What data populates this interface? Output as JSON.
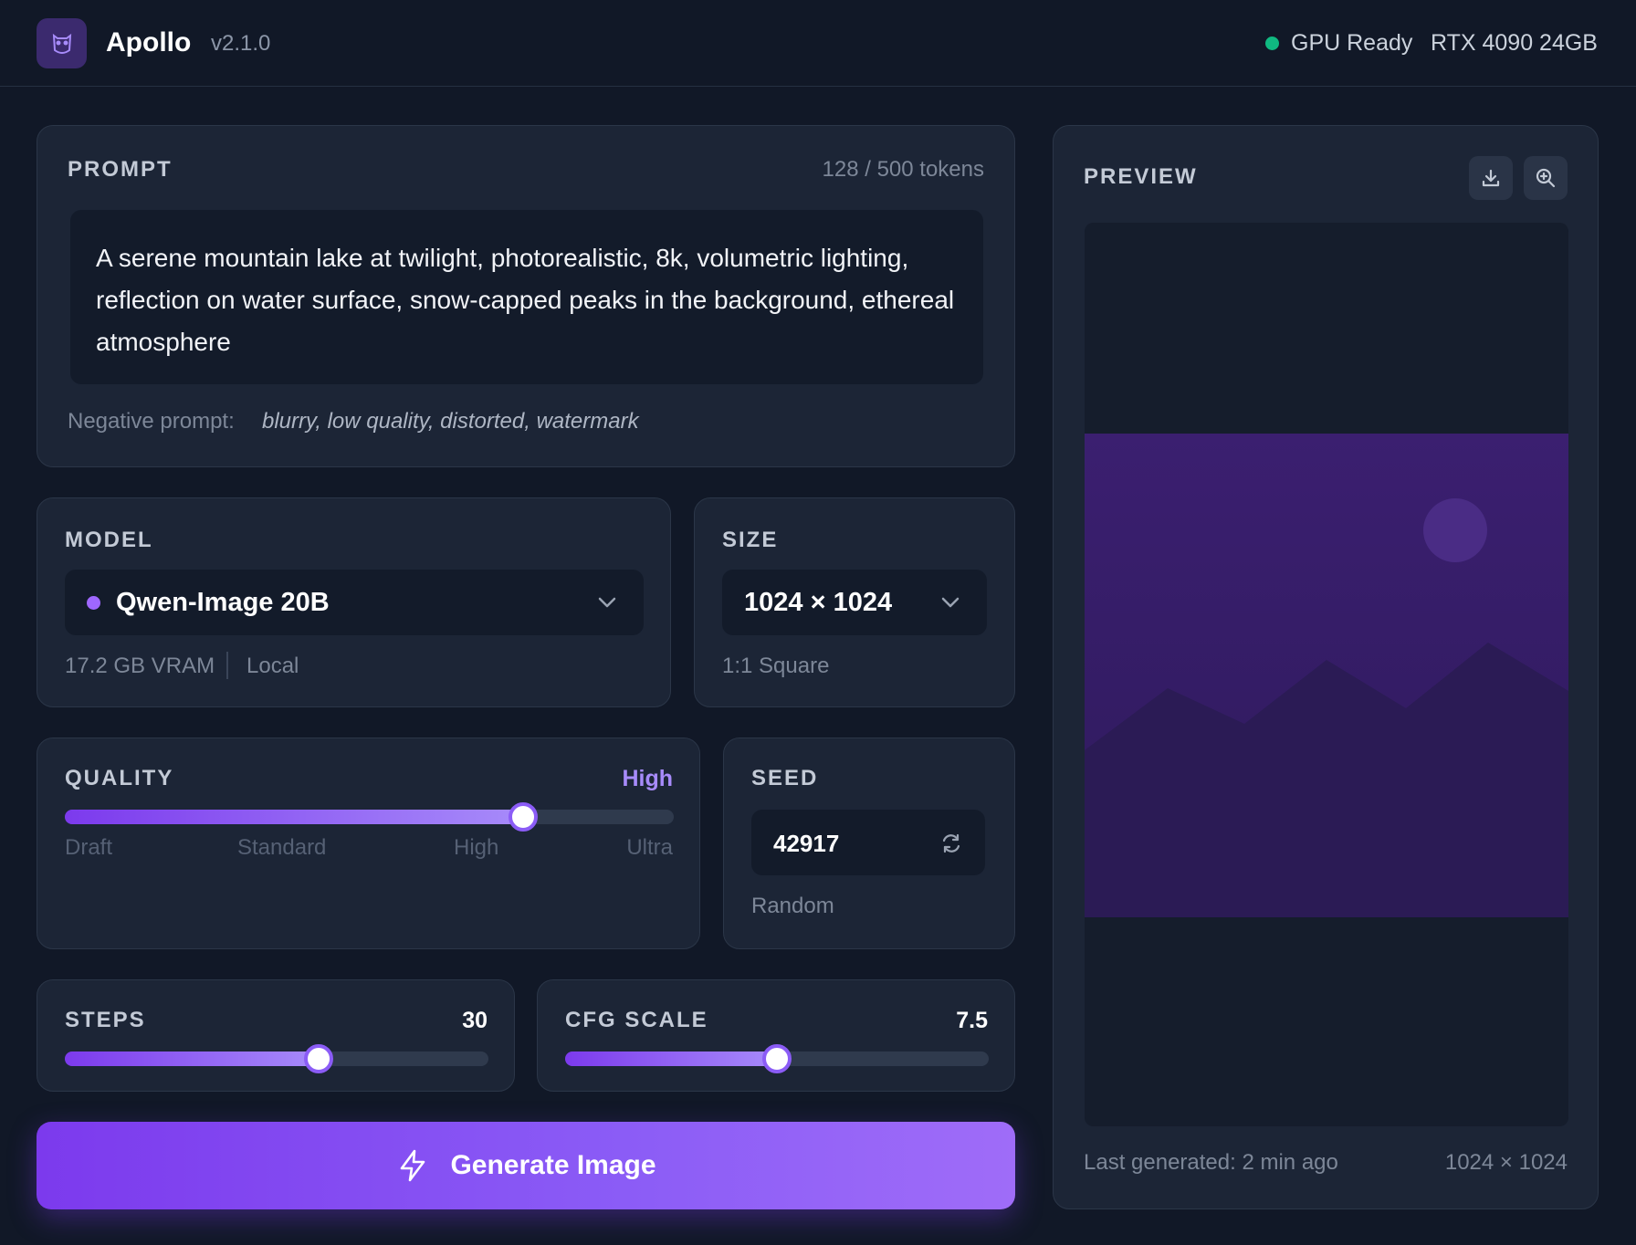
{
  "header": {
    "app_name": "Apollo",
    "version": "v2.1.0",
    "gpu_status": "GPU Ready",
    "gpu_model": "RTX 4090 24GB",
    "status_color": "#10b981",
    "logo_icon": "owl-icon"
  },
  "prompt": {
    "label": "PROMPT",
    "token_count": "128 / 500 tokens",
    "text": "A serene mountain lake at twilight, photorealistic, 8k, volumetric lighting, reflection on water surface, snow-capped peaks in the background, ethereal atmosphere",
    "negative_label": "Negative prompt:",
    "negative_value": "blurry, low quality, distorted, watermark"
  },
  "model": {
    "label": "MODEL",
    "selected": "Qwen-Image 20B",
    "vram": "17.2 GB VRAM",
    "location": "Local",
    "dot_color": "#9f67ff"
  },
  "size": {
    "label": "SIZE",
    "selected": "1024 × 1024",
    "aspect": "1:1 Square"
  },
  "quality": {
    "label": "QUALITY",
    "value": "High",
    "level_fraction": 0.752,
    "ticks": [
      "Draft",
      "Standard",
      "High",
      "Ultra"
    ]
  },
  "seed": {
    "label": "SEED",
    "value": "42917",
    "mode": "Random"
  },
  "steps": {
    "label": "STEPS",
    "value": "30",
    "level_fraction": 0.6
  },
  "cfg": {
    "label": "CFG SCALE",
    "value": "7.5",
    "level_fraction": 0.5
  },
  "generate": {
    "label": "Generate Image",
    "accent": "#7c3aed"
  },
  "preview": {
    "label": "PREVIEW",
    "last_generated": "Last generated: 2 min ago",
    "dimensions": "1024 × 1024"
  }
}
